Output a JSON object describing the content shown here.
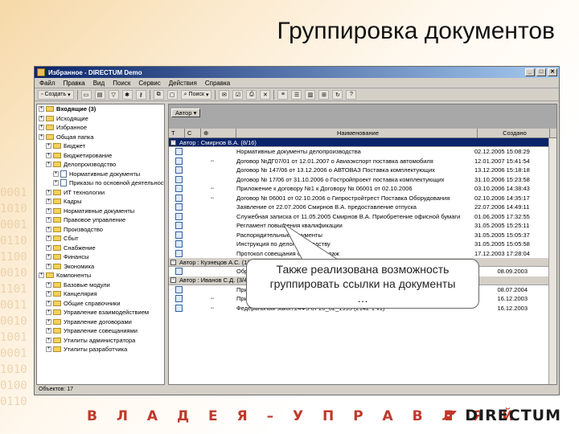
{
  "slide": {
    "title": "Группировка документов",
    "slogan": "В Л А Д Е Я – У П Р А В Л Я Й",
    "logo_text": "DIRECTUM",
    "binary_text": "0001\n1010\n0001\n0110\n1100\n0010\n1101\n0011\n0010\n1001\n0001\n1010\n0100\n0110"
  },
  "window": {
    "title": "Избранное - DIRECTUM Demo",
    "buttons": [
      "_",
      "□",
      "✕"
    ],
    "menu": [
      "Файл",
      "Правка",
      "Вид",
      "Поиск",
      "Сервис",
      "Действия",
      "Справка"
    ],
    "toolbar_create": "Создать",
    "toolbar_search": "Поиск"
  },
  "tree": {
    "items": [
      {
        "label": "Входящие (3)",
        "indent": 0,
        "bold": true
      },
      {
        "label": "Исходящие",
        "indent": 0,
        "bold": false
      },
      {
        "label": "Избранное",
        "indent": 0,
        "bold": false
      },
      {
        "label": "Общая папка",
        "indent": 0,
        "bold": false
      },
      {
        "label": "Бюджет",
        "indent": 1,
        "bold": false
      },
      {
        "label": "Бюджетирование",
        "indent": 1,
        "bold": false
      },
      {
        "label": "Делопроизводство",
        "indent": 1,
        "bold": false
      },
      {
        "label": "Нормативные документы",
        "indent": 2,
        "bold": false
      },
      {
        "label": "Приказы по основной деятельности",
        "indent": 2,
        "bold": false
      },
      {
        "label": "ИТ технологии",
        "indent": 1,
        "bold": false
      },
      {
        "label": "Кадры",
        "indent": 1,
        "bold": false
      },
      {
        "label": "Нормативные документы",
        "indent": 1,
        "bold": false
      },
      {
        "label": "Правовое управление",
        "indent": 1,
        "bold": false
      },
      {
        "label": "Производство",
        "indent": 1,
        "bold": false
      },
      {
        "label": "Сбыт",
        "indent": 1,
        "bold": false
      },
      {
        "label": "Снабжение",
        "indent": 1,
        "bold": false
      },
      {
        "label": "Финансы",
        "indent": 1,
        "bold": false
      },
      {
        "label": "Экономика",
        "indent": 1,
        "bold": false
      },
      {
        "label": "Компоненты",
        "indent": 0,
        "bold": false
      },
      {
        "label": "Базовые модули",
        "indent": 1,
        "bold": false
      },
      {
        "label": "Канцелярия",
        "indent": 1,
        "bold": false
      },
      {
        "label": "Общие справочники",
        "indent": 1,
        "bold": false
      },
      {
        "label": "Управление взаимодействием",
        "indent": 1,
        "bold": false
      },
      {
        "label": "Управление договорами",
        "indent": 1,
        "bold": false
      },
      {
        "label": "Управление совещаниями",
        "indent": 1,
        "bold": false
      },
      {
        "label": "Утилиты администратора",
        "indent": 1,
        "bold": false
      },
      {
        "label": "Утилиты разработчика",
        "indent": 1,
        "bold": false
      }
    ]
  },
  "list": {
    "group_by_chip": "Автор",
    "columns": [
      "Т",
      "С",
      "⊕",
      "Наименование",
      "Создано"
    ],
    "groups": [
      {
        "label": "Автор : Смирнов В.А. (8/16)",
        "selected": true,
        "rows": [
          {
            "link": "",
            "name": "Нормативные документы делопроизводства",
            "date": "02.12.2005 15:08:29"
          },
          {
            "link": "⇔",
            "name": "Договор №ДГ07/01 от 12.01.2007 о Авиаэкспорт поставка автомобиля",
            "date": "12.01.2007 15:41:54"
          },
          {
            "link": "",
            "name": "Договор № 147/06 от 13.12.2006 о АВТОВАЗ Поставка комплектующих",
            "date": "13.12.2006 15:18:18"
          },
          {
            "link": "",
            "name": "Договор № 17/06 от 31.10.2006 о Гостройпроект поставка комплектующих",
            "date": "31.10.2006 15:23:58"
          },
          {
            "link": "⇔",
            "name": "Приложение к договору №1 к Договору № 06001 от 02.10.2006",
            "date": "03.10.2006 14:38:43"
          },
          {
            "link": "⇔",
            "name": "Договор № 06001 от 02.10.2006 о Гипростройтрест Поставка Оборудования",
            "date": "02.10.2006 14:35:17"
          },
          {
            "link": "",
            "name": "Заявление от 22.07.2006 Смирнов В.А. предоставление отпуска",
            "date": "22.07.2006 14:49:11"
          },
          {
            "link": "",
            "name": "Служебная записка от 11.05.2005 Смирнов В.А. Приобретение офисной бумаги",
            "date": "01.06.2005 17:32:55"
          },
          {
            "link": "",
            "name": "Регламент повышения квалификации",
            "date": "31.05.2005 15:25:11"
          },
          {
            "link": "",
            "name": "Распорядительные документы",
            "date": "31.05.2005 15:05:37"
          },
          {
            "link": "",
            "name": "Инструкция по делопроизводству",
            "date": "31.05.2005 15:05:58"
          },
          {
            "link": "",
            "name": "Протокол совещания отдела продаж",
            "date": "17.12.2003 17:28:04"
          }
        ]
      },
      {
        "label": "Автор : Кузнецов А.С. (1/1)",
        "selected": false,
        "rows": [
          {
            "link": "",
            "name": "Образцы документов",
            "date": "08.09.2003"
          }
        ]
      },
      {
        "label": "Автор : Иванов С.Д. (3/4)",
        "selected": false,
        "rows": [
          {
            "link": "",
            "name": "Приказ №ДО00002 от 01.07.2005 Зачисление в штат",
            "date": "08.07.2004"
          },
          {
            "link": "⇔",
            "name": "Приложение №3 к Положению о предоставлении информации полномочий",
            "date": "16.12.2003"
          },
          {
            "link": "⇔",
            "name": "Федеральный закон 24ФЗ от 20_02_1995 (2142-1 v1)",
            "date": "16.12.2003"
          }
        ]
      }
    ]
  },
  "status_bar": "Объектов: 17",
  "callout": {
    "line1": "Также реализована возможность",
    "line2": "группировать ссылки на документы",
    "line3": "…"
  },
  "colors": {
    "accent_red": "#c0392b",
    "selection_blue": "#0a246a",
    "chrome_gray": "#d4d0c8"
  }
}
